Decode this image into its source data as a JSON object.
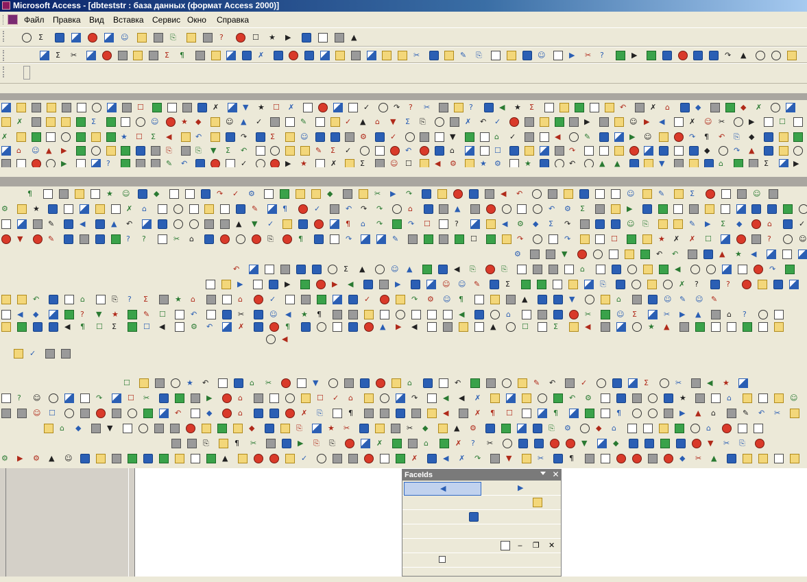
{
  "window": {
    "title": "Microsoft Access - [dbteststr : база данных (формат Access 2000)]"
  },
  "menubar": {
    "items": [
      {
        "label": "Файл"
      },
      {
        "label": "Правка"
      },
      {
        "label": "Вид"
      },
      {
        "label": "Вставка"
      },
      {
        "label": "Сервис"
      },
      {
        "label": "Окно"
      },
      {
        "label": "Справка"
      }
    ]
  },
  "faceids": {
    "title": "FaceIds"
  },
  "colors": {
    "titlebar_start": "#0a246a",
    "titlebar_end": "#a6caf0",
    "toolbar_bg": "#ece9d8",
    "selection": "#c1d2ee",
    "selection_border": "#316ac5"
  }
}
